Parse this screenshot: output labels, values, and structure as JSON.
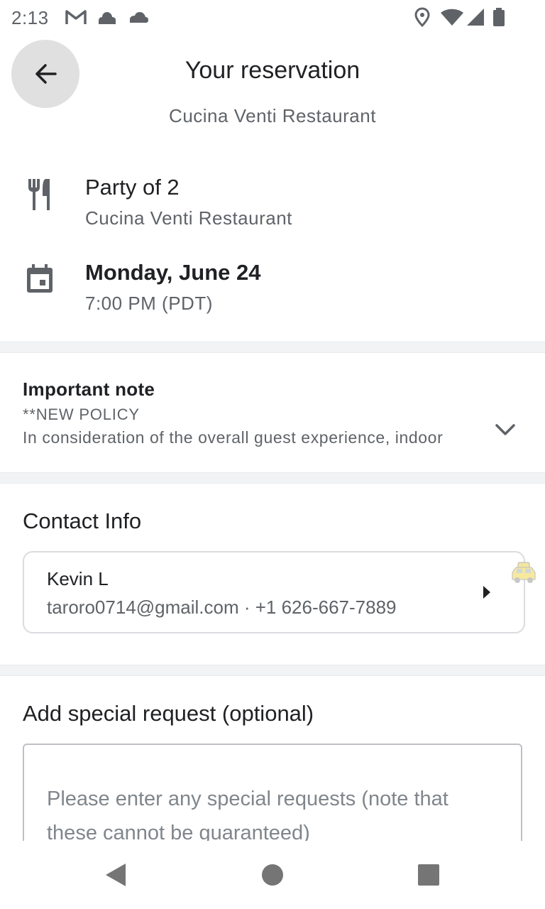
{
  "status_bar": {
    "time": "2:13",
    "left_icons": [
      "gmail-icon",
      "cloud-icon",
      "cloud-icon"
    ],
    "right_icons": [
      "location-icon",
      "wifi-icon",
      "signal-icon",
      "battery-icon"
    ]
  },
  "header": {
    "title": "Your reservation",
    "subtitle": "Cucina Venti Restaurant"
  },
  "details": {
    "party": {
      "icon": "restaurant-icon",
      "main": "Party of 2",
      "sub": "Cucina Venti Restaurant"
    },
    "date": {
      "icon": "calendar-icon",
      "main": "Monday, June 24",
      "sub": "7:00 PM (PDT)"
    }
  },
  "note": {
    "title": "Important note",
    "line1": "**NEW POLICY",
    "line2": "In consideration of the overall guest experience, indoor"
  },
  "contact": {
    "title": "Contact Info",
    "name": "Kevin L",
    "detail": "taroro0714@gmail.com · +1 626-667-7889"
  },
  "special_request": {
    "title": "Add special request (optional)",
    "placeholder": "Please enter any special requests (note that these cannot be guaranteed)"
  },
  "colors": {
    "primary_text": "#202124",
    "secondary_text": "#5f6368",
    "divider": "#f1f3f4",
    "back_button_bg": "#e0e0e0"
  }
}
